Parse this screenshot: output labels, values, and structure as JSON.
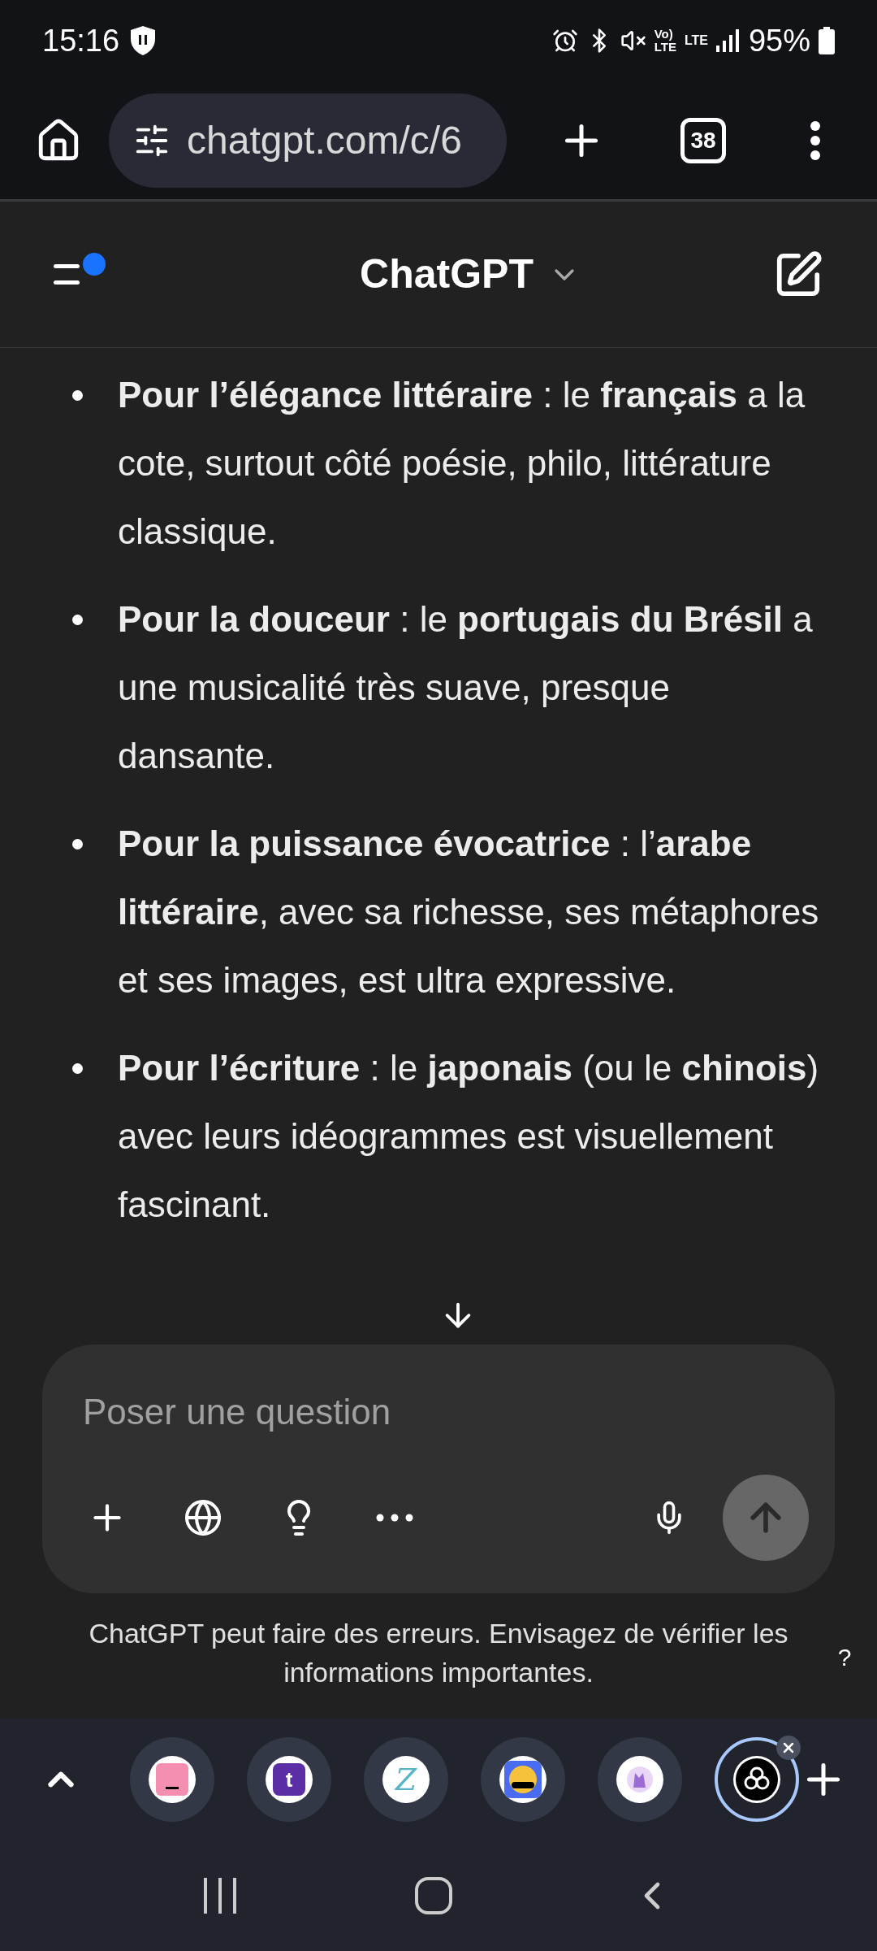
{
  "status_bar": {
    "time": "15:16",
    "volte_top": "Vo)",
    "volte_bottom": "LTE",
    "lte": "LTE",
    "battery": "95%"
  },
  "browser": {
    "url": "chatgpt.com/c/6",
    "tab_count": "38"
  },
  "header": {
    "title": "ChatGPT",
    "notification_dot": true
  },
  "message": {
    "bullets": [
      "**Pour l’élégance littéraire** : le **français** a la cote, surtout côté poésie, philo, littérature classique.",
      "**Pour la douceur** : le **portugais du Brésil** a une musicalité très suave, presque dansante.",
      "**Pour la puissance évocatrice** : l’**arabe littéraire**, avec sa richesse, ses métaphores et ses images, est ultra expressive.",
      "**Pour l’écriture** : le **japonais** (ou le **chinois**) avec leurs idéogrammes est visuellement fascinant."
    ]
  },
  "composer": {
    "placeholder": "Poser une question"
  },
  "disclaimer": "ChatGPT peut faire des erreurs. Envisagez de vérifier les informations importantes.",
  "help": "?",
  "tab_group": {
    "tabs": [
      {
        "kind": "square",
        "color": "#f48fb1",
        "selected": false
      },
      {
        "kind": "letter",
        "glyph": "t",
        "color": "#5b2ea6",
        "selected": false
      },
      {
        "kind": "script",
        "glyph": "Z",
        "color": "#ffffff",
        "selected": false
      },
      {
        "kind": "emoji",
        "color": "#4a6cf0",
        "selected": false
      },
      {
        "kind": "cat",
        "color": "#ffffff",
        "selected": false
      },
      {
        "kind": "knot",
        "color": "#000000",
        "selected": true
      }
    ]
  }
}
